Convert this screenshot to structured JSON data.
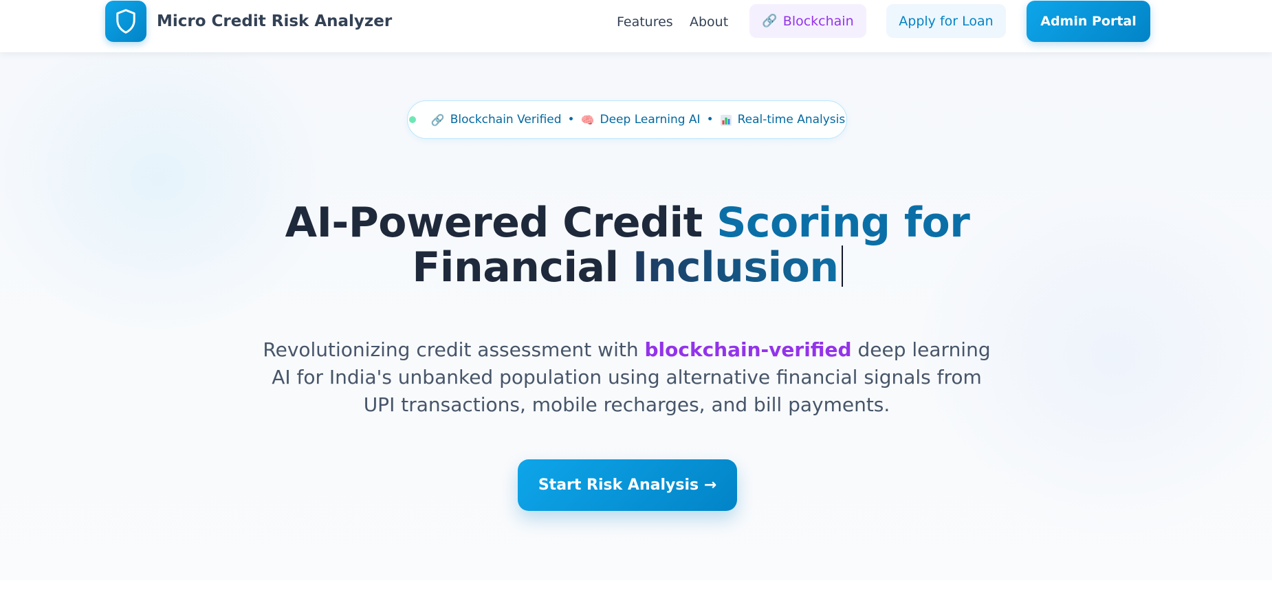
{
  "header": {
    "brand": "Micro Credit Risk Analyzer",
    "logo_icon": "shield-icon",
    "nav": {
      "features": "Features",
      "about": "About"
    },
    "blockchain_button": {
      "icon": "link-icon",
      "label": "Blockchain"
    },
    "apply_button": "Apply for Loan",
    "admin_button": "Admin Portal"
  },
  "hero": {
    "badge": {
      "items": [
        {
          "icon": "link-icon",
          "label": "Blockchain Verified"
        },
        {
          "icon": "brain-icon",
          "label": "Deep Learning AI"
        },
        {
          "icon": "bar-chart-icon",
          "label": "Real-time Analysis"
        }
      ],
      "separator": "•"
    },
    "title": {
      "part1": "AI-Powered Credit ",
      "part2": "Scoring for",
      "part3": "Financial ",
      "part4": "Inclusion"
    },
    "subtitle": {
      "before": "Revolutionizing credit assessment with ",
      "highlight": "blockchain-verified",
      "after": " deep learning AI for India's unbanked population using alternative financial signals from UPI transactions, mobile recharges, and bill payments."
    },
    "cta": "Start Risk Analysis →"
  },
  "colors": {
    "primary": "#0284c7",
    "primary_light": "#0ea5e9",
    "accent_purple": "#9333ea",
    "text_dark": "#1e293b",
    "text_muted": "#475569",
    "status_dot": "#6ee7b7"
  }
}
